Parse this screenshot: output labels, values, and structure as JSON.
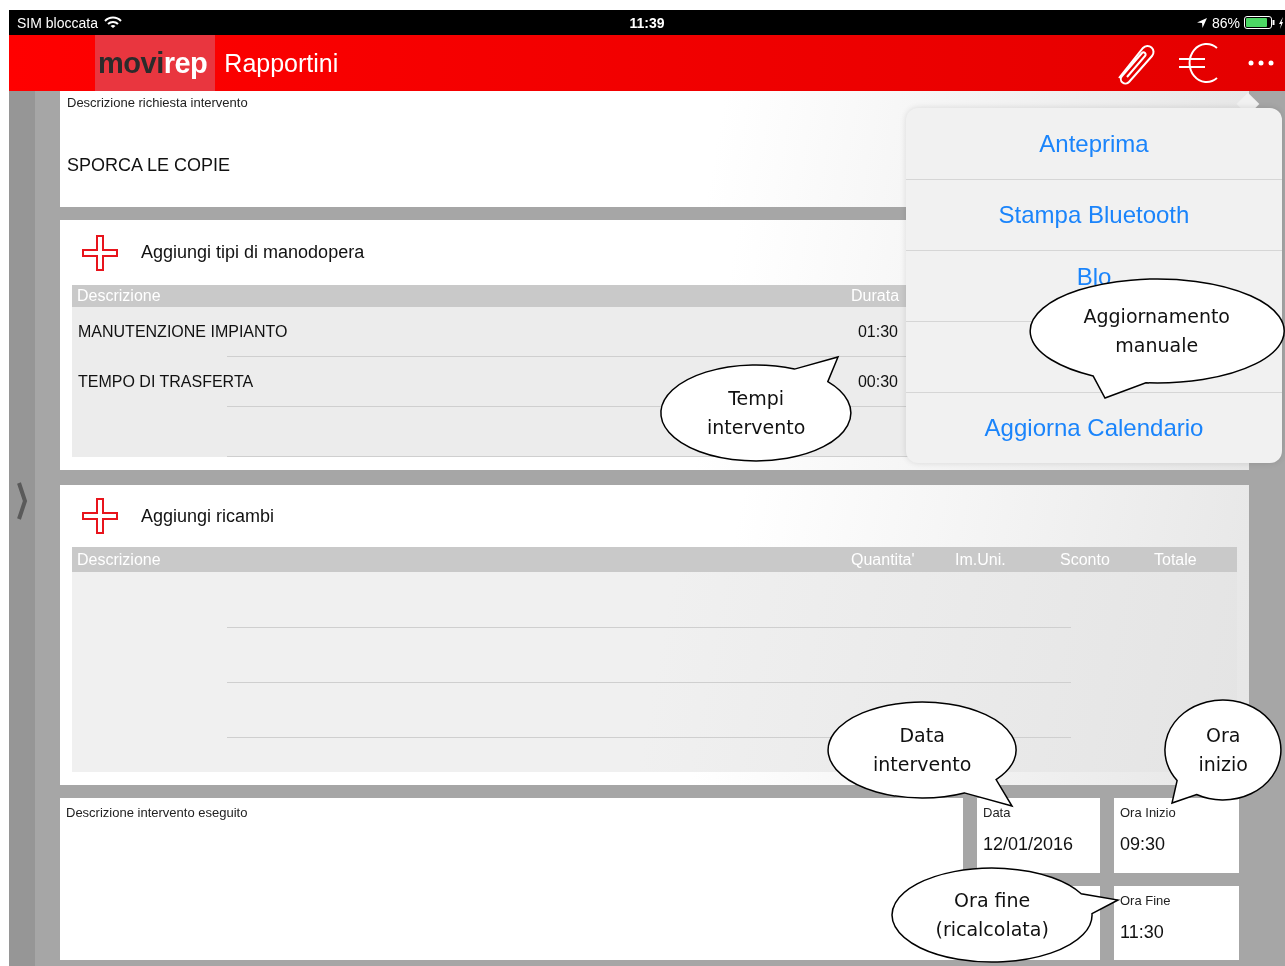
{
  "status_bar": {
    "carrier": "SIM bloccata",
    "time": "11:39",
    "battery": "86%"
  },
  "nav_bar": {
    "logo": [
      "movi",
      "rep"
    ],
    "title": "Rapportini"
  },
  "request_panel": {
    "label": "Descrizione richiesta intervento",
    "value": "SPORCA LE COPIE"
  },
  "labor_panel": {
    "add_label": "Aggiungi tipi di manodopera",
    "columns": [
      "Descrizione",
      "Durata"
    ],
    "rows": [
      {
        "description": "MANUTENZIONE IMPIANTO",
        "duration": "01:30"
      },
      {
        "description": "TEMPO DI TRASFERTA",
        "duration": "00:30"
      }
    ]
  },
  "parts_panel": {
    "add_label": "Aggiungi ricambi",
    "columns": [
      "Descrizione",
      "Quantita'",
      "Im.Uni.",
      "Sconto",
      "Totale"
    ]
  },
  "work_description": {
    "label": "Descrizione intervento eseguito"
  },
  "date_field": {
    "label": "Data",
    "value": "12/01/2016"
  },
  "start_field": {
    "label": "Ora Inizio",
    "value": "09:30"
  },
  "end_field": {
    "label": "Ora Fine",
    "value": "11:30"
  },
  "menu": {
    "items": [
      {
        "label": "Anteprima"
      },
      {
        "label": "Stampa Bluetooth"
      },
      {
        "label": "Blo"
      },
      {
        "covered": true
      },
      {
        "label": "Aggiorna Calendario"
      }
    ]
  },
  "callouts": [
    {
      "lines": [
        "Tempi",
        "intervento"
      ]
    },
    {
      "lines": [
        "Aggiornamento",
        "manuale"
      ]
    },
    {
      "lines": [
        "Data",
        "intervento"
      ]
    },
    {
      "lines": [
        "Ora",
        "inizio"
      ]
    },
    {
      "lines": [
        "Ora fine",
        "(ricalcolata)"
      ]
    }
  ]
}
